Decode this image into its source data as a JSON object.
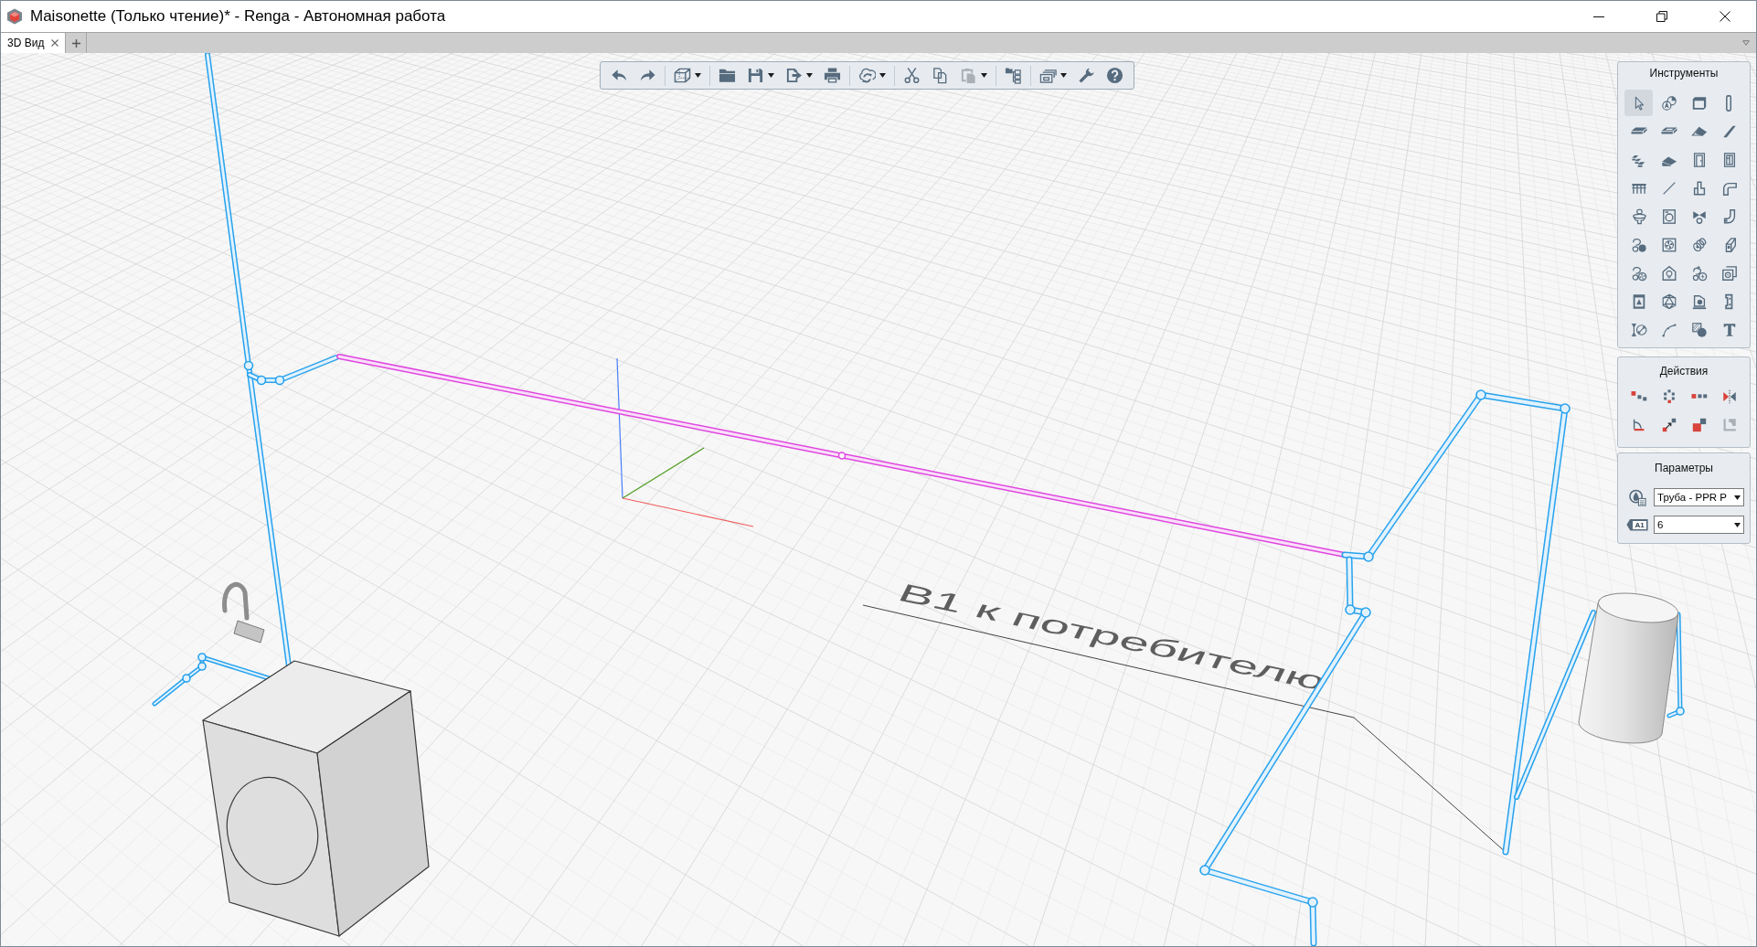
{
  "window": {
    "title": "Maisonette (Только чтение)* - Renga - Автономная работа"
  },
  "tabs": [
    {
      "label": "3D Вид",
      "selected": true
    }
  ],
  "toolbar": [
    {
      "kind": "button",
      "dropdown": false,
      "disabled": false
    },
    {
      "kind": "button",
      "dropdown": false,
      "disabled": false
    },
    {
      "kind": "separator"
    },
    {
      "kind": "button",
      "dropdown": true,
      "disabled": false
    },
    {
      "kind": "separator"
    },
    {
      "kind": "button",
      "dropdown": false,
      "disabled": false
    },
    {
      "kind": "button",
      "dropdown": true,
      "disabled": false
    },
    {
      "kind": "button",
      "dropdown": true,
      "disabled": false
    },
    {
      "kind": "button",
      "dropdown": false,
      "disabled": false
    },
    {
      "kind": "separator"
    },
    {
      "kind": "button",
      "dropdown": true,
      "disabled": false
    },
    {
      "kind": "separator"
    },
    {
      "kind": "button",
      "dropdown": false,
      "disabled": false
    },
    {
      "kind": "button",
      "dropdown": false,
      "disabled": false
    },
    {
      "kind": "button",
      "dropdown": true,
      "disabled": true
    },
    {
      "kind": "separator"
    },
    {
      "kind": "button",
      "dropdown": false,
      "disabled": false
    },
    {
      "kind": "separator"
    },
    {
      "kind": "button",
      "dropdown": true,
      "disabled": false
    },
    {
      "kind": "button",
      "dropdown": false,
      "disabled": false
    },
    {
      "kind": "button",
      "dropdown": false,
      "disabled": false
    }
  ],
  "tools": {
    "title": "Инструменты",
    "items": [
      {
        "selected": true
      },
      {
        "selected": false
      },
      {
        "selected": false
      },
      {
        "selected": false
      },
      {
        "selected": false
      },
      {
        "selected": false
      },
      {
        "selected": false
      },
      {
        "selected": false
      },
      {
        "selected": false
      },
      {
        "selected": false
      },
      {
        "selected": false
      },
      {
        "selected": false
      },
      {
        "selected": false
      },
      {
        "selected": false
      },
      {
        "selected": false
      },
      {
        "selected": false
      },
      {
        "selected": false
      },
      {
        "selected": false
      },
      {
        "selected": false
      },
      {
        "selected": false
      },
      {
        "selected": false
      },
      {
        "selected": false
      },
      {
        "selected": false
      },
      {
        "selected": false
      },
      {
        "selected": false
      },
      {
        "selected": false
      },
      {
        "selected": false
      },
      {
        "selected": false
      },
      {
        "selected": false
      },
      {
        "selected": false
      },
      {
        "selected": false
      },
      {
        "selected": false
      },
      {
        "selected": false
      },
      {
        "selected": false
      },
      {
        "selected": false
      },
      {
        "selected": false
      }
    ]
  },
  "actions": {
    "title": "Действия",
    "items": [
      {
        "disabled": false
      },
      {
        "disabled": false
      },
      {
        "disabled": false
      },
      {
        "disabled": false
      },
      {
        "disabled": false
      },
      {
        "disabled": false
      },
      {
        "disabled": false
      },
      {
        "disabled": true
      }
    ]
  },
  "parameters": {
    "title": "Параметры",
    "fields": [
      {
        "value": "Труба - PPR P"
      },
      {
        "tag": "A1",
        "value": "6"
      }
    ]
  },
  "scene": {
    "label": "В1 к потребителю",
    "pipes": [
      {
        "selected": false
      },
      {
        "selected": false
      },
      {
        "selected": true
      },
      {
        "selected": false
      },
      {
        "selected": false
      },
      {
        "selected": false
      },
      {
        "selected": false
      },
      {
        "selected": false
      }
    ]
  }
}
